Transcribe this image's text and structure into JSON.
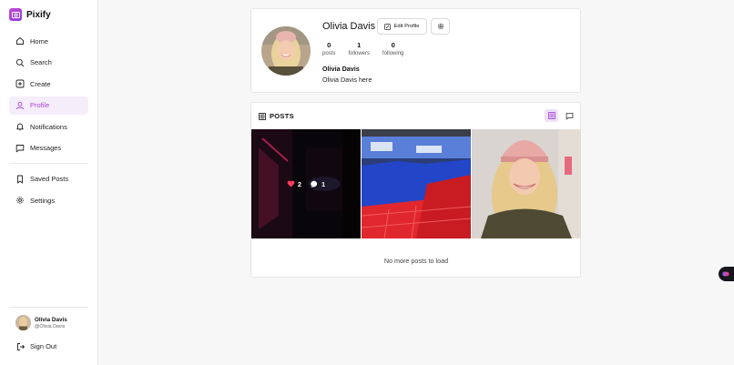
{
  "app": {
    "name": "Pixify",
    "brand_color": "#a443d3"
  },
  "sidebar": {
    "items": [
      {
        "label": "Home",
        "icon": "home-icon"
      },
      {
        "label": "Search",
        "icon": "search-icon"
      },
      {
        "label": "Create",
        "icon": "plus-square-icon"
      },
      {
        "label": "Profile",
        "icon": "user-icon",
        "active": true
      },
      {
        "label": "Notifications",
        "icon": "bell-icon"
      },
      {
        "label": "Messages",
        "icon": "message-icon"
      }
    ],
    "secondary": [
      {
        "label": "Saved Posts",
        "icon": "bookmark-icon"
      },
      {
        "label": "Settings",
        "icon": "gear-icon"
      }
    ],
    "user": {
      "name": "Olivia Davis",
      "handle": "@Olivia Davis"
    },
    "signout_label": "Sign Out"
  },
  "profile": {
    "username": "Olivia Davis",
    "edit_label": "Edit Profile",
    "stats": [
      {
        "value": "0",
        "label": "posts"
      },
      {
        "value": "1",
        "label": "followers"
      },
      {
        "value": "0",
        "label": "following"
      }
    ],
    "display_name": "Olivia Davis",
    "bio": "Olivia Davis here"
  },
  "posts": {
    "title": "POSTS",
    "first_tile": {
      "likes": "2",
      "comments": "1"
    },
    "end_message": "No more posts to load"
  }
}
